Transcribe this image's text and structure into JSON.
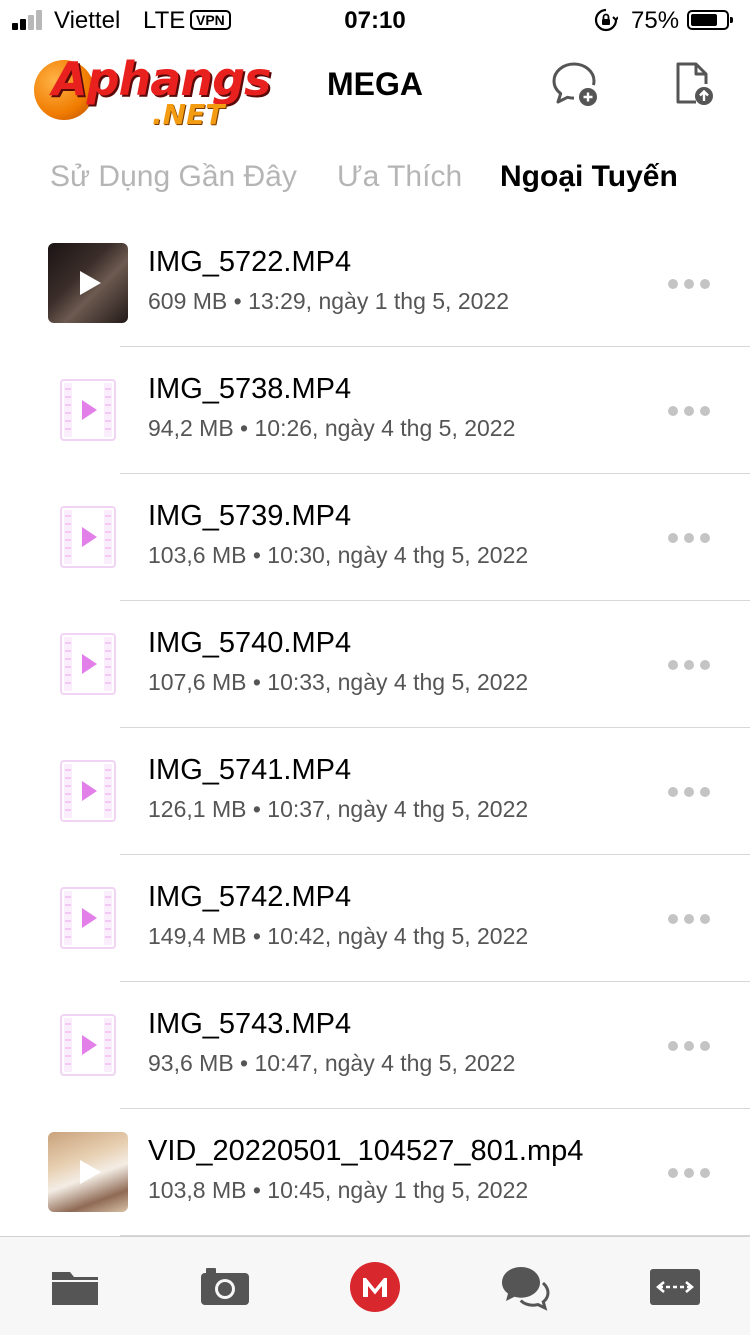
{
  "status_bar": {
    "carrier": "Viettel",
    "network": "LTE",
    "vpn": "VPN",
    "time": "07:10",
    "battery": "75%",
    "battery_level": 0.75
  },
  "header": {
    "logo_main": "Aphangs",
    "logo_sub": ".NET",
    "title": "MEGA",
    "icons": [
      "new-chat-icon",
      "upload-file-icon"
    ]
  },
  "tabs": [
    {
      "label": "Sử Dụng Gần Đây",
      "active": false
    },
    {
      "label": "Ưa Thích",
      "active": false
    },
    {
      "label": "Ngoại Tuyến",
      "active": true
    }
  ],
  "files": [
    {
      "name": "IMG_5722.MP4",
      "size": "609 MB",
      "date": "13:29, ngày 1 thg 5, 2022",
      "thumb": "video-thumbnail-dark"
    },
    {
      "name": "IMG_5738.MP4",
      "size": "94,2 MB",
      "date": "10:26, ngày 4 thg 5, 2022",
      "thumb": "video-file-icon"
    },
    {
      "name": "IMG_5739.MP4",
      "size": "103,6 MB",
      "date": "10:30, ngày 4 thg 5, 2022",
      "thumb": "video-file-icon"
    },
    {
      "name": "IMG_5740.MP4",
      "size": "107,6 MB",
      "date": "10:33, ngày 4 thg 5, 2022",
      "thumb": "video-file-icon"
    },
    {
      "name": "IMG_5741.MP4",
      "size": "126,1 MB",
      "date": "10:37, ngày 4 thg 5, 2022",
      "thumb": "video-file-icon"
    },
    {
      "name": "IMG_5742.MP4",
      "size": "149,4 MB",
      "date": "10:42, ngày 4 thg 5, 2022",
      "thumb": "video-file-icon"
    },
    {
      "name": "IMG_5743.MP4",
      "size": "93,6 MB",
      "date": "10:47, ngày 4 thg 5, 2022",
      "thumb": "video-file-icon"
    },
    {
      "name": "VID_20220501_104527_801.mp4",
      "size": "103,8 MB",
      "date": "10:45, ngày 1 thg 5, 2022",
      "thumb": "video-thumbnail-photo"
    }
  ],
  "meta_separator": "•",
  "tab_bar": [
    "cloud-drive-icon",
    "camera-uploads-icon",
    "mega-home-icon",
    "chat-icon",
    "transfers-icon"
  ],
  "colors": {
    "mega_red": "#D9272E",
    "tab_inactive": "#B5B5B5",
    "icon_gray": "#555555",
    "video_icon": "#E37FE8"
  }
}
